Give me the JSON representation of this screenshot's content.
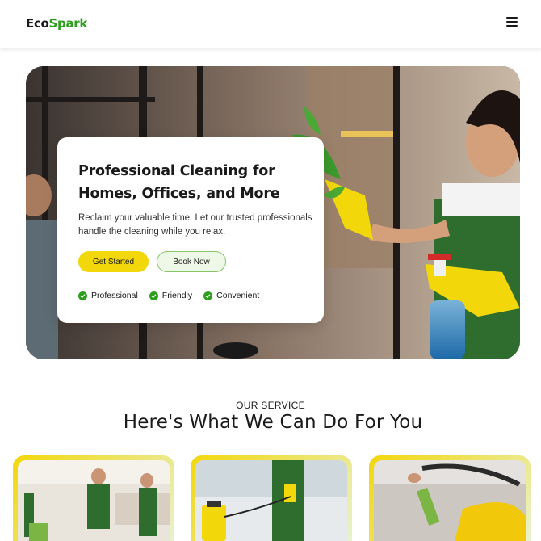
{
  "header": {
    "logo_part1": "Eco",
    "logo_part2": "Spark",
    "menu_icon": "hamburger-menu-icon"
  },
  "hero": {
    "title": "Professional Cleaning for Homes, Offices, and More",
    "description": "Reclaim your valuable time. Let our trusted professionals handle the cleaning while you relax.",
    "primary_button": "Get Started",
    "secondary_button": "Book Now",
    "features": [
      "Professional",
      "Friendly",
      "Convenient"
    ]
  },
  "services": {
    "eyebrow": "OUR SERVICE",
    "title": "Here's What We Can Do For You"
  },
  "colors": {
    "brand_green": "#2e9e1f",
    "accent_yellow": "#f2d70b"
  }
}
